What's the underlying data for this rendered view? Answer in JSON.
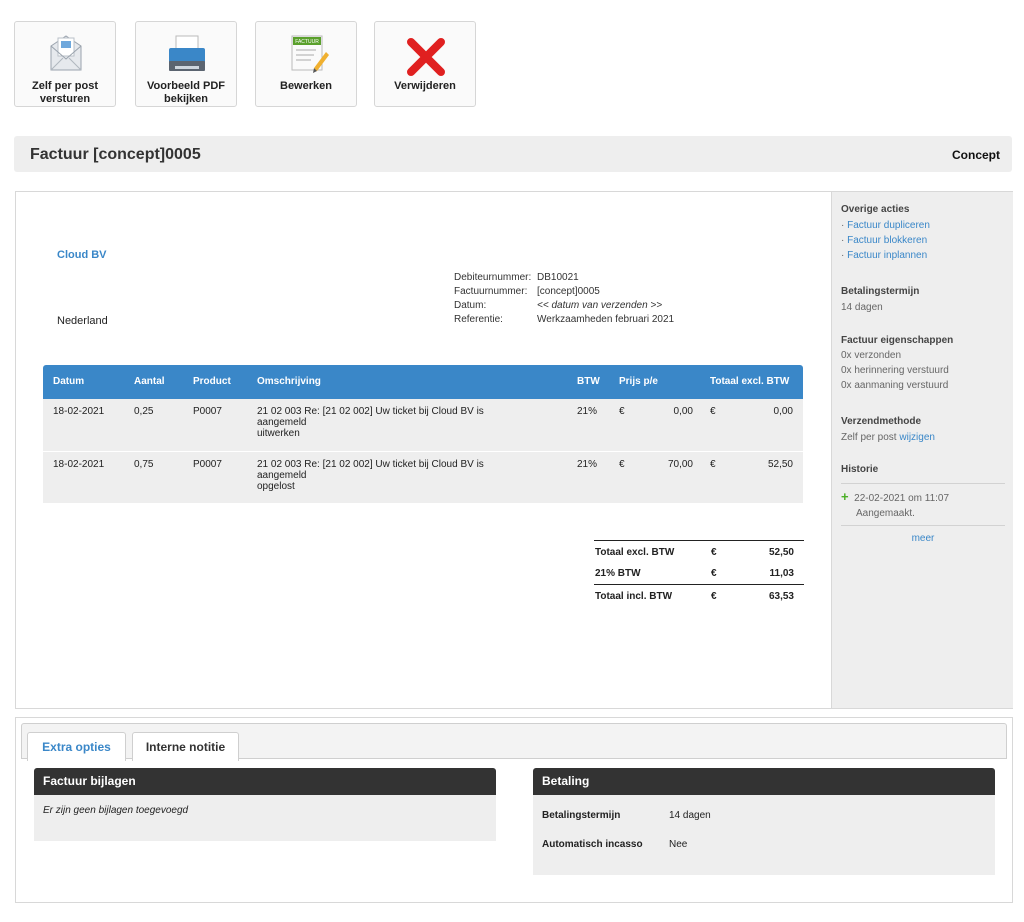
{
  "toolbar": {
    "buttons": [
      {
        "label": "Zelf per post\nversturen",
        "icon": "envelope-icon"
      },
      {
        "label": "Voorbeeld PDF\nbekijken",
        "icon": "printer-icon"
      },
      {
        "label": "Bewerken",
        "icon": "edit-invoice-icon",
        "icon_text": "FACTUUR"
      },
      {
        "label": "Verwijderen",
        "icon": "delete-x-icon"
      }
    ]
  },
  "header": {
    "title": "Factuur [concept]0005",
    "status": "Concept"
  },
  "invoice": {
    "company": "Cloud BV",
    "country": "Nederland",
    "meta": [
      {
        "label": "Debiteurnummer:",
        "value": "DB10021"
      },
      {
        "label": "Factuurnummer:",
        "value": "[concept]0005"
      },
      {
        "label": "Datum:",
        "value": "<< datum van verzenden >>"
      },
      {
        "label": "Referentie:",
        "value": "Werkzaamheden februari 2021"
      }
    ],
    "columns": {
      "datum": "Datum",
      "aantal": "Aantal",
      "product": "Product",
      "omschrijving": "Omschrijving",
      "btw": "BTW",
      "prijs": "Prijs p/e",
      "totaal": "Totaal excl. BTW"
    },
    "rows": [
      {
        "datum": "18-02-2021",
        "aantal": "0,25",
        "product": "P0007",
        "omschrijving": [
          "21 02 003 Re: [21 02 002] Uw ticket bij Cloud BV is",
          "aangemeld",
          "uitwerken"
        ],
        "btw": "21%",
        "cur1": "€",
        "prijs": "0,00",
        "cur2": "€",
        "totaal": "0,00"
      },
      {
        "datum": "18-02-2021",
        "aantal": "0,75",
        "product": "P0007",
        "omschrijving": [
          "21 02 003 Re: [21 02 002] Uw ticket bij Cloud BV is",
          "aangemeld",
          "opgelost"
        ],
        "btw": "21%",
        "cur1": "€",
        "prijs": "70,00",
        "cur2": "€",
        "totaal": "52,50"
      }
    ],
    "totals": [
      {
        "label": "Totaal excl. BTW",
        "cur": "€",
        "value": "52,50"
      },
      {
        "label": "21% BTW",
        "cur": "€",
        "value": "11,03"
      },
      {
        "label": "Totaal incl. BTW",
        "cur": "€",
        "value": "63,53"
      }
    ]
  },
  "sidebar": {
    "overige_title": "Overige acties",
    "overige_links": [
      "Factuur dupliceren",
      "Factuur blokkeren",
      "Factuur inplannen"
    ],
    "termijn_title": "Betalingstermijn",
    "termijn_value": "14 dagen",
    "eigenschappen_title": "Factuur eigenschappen",
    "eigenschappen": [
      "0x verzonden",
      "0x herinnering verstuurd",
      "0x aanmaning verstuurd"
    ],
    "verzend_title": "Verzendmethode",
    "verzend_value": "Zelf per post",
    "verzend_link": "wijzigen",
    "historie_title": "Historie",
    "historie_items": [
      {
        "date": "22-02-2021 om 11:07",
        "text": "Aangemaakt."
      }
    ],
    "meer": "meer",
    "plus_color": "#4caf27"
  },
  "bottom": {
    "tabs": [
      {
        "label": "Extra opties",
        "active": true
      },
      {
        "label": "Interne notitie",
        "active": false
      }
    ],
    "bijlagen_title": "Factuur bijlagen",
    "bijlagen_empty": "Er zijn geen bijlagen toegevoegd",
    "betaling_title": "Betaling",
    "betaling_rows": [
      {
        "label": "Betalingstermijn",
        "value": "14 dagen"
      },
      {
        "label": "Automatisch incasso",
        "value": "Nee"
      }
    ]
  },
  "colors": {
    "accent": "#3a87c8",
    "dark_header": "#333333",
    "delete": "#e02020"
  }
}
